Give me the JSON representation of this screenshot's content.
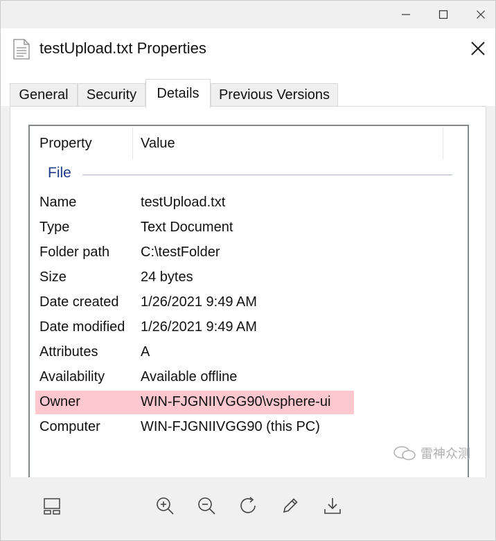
{
  "window": {
    "title": "testUpload.txt Properties"
  },
  "tabs": [
    {
      "label": "General",
      "active": false
    },
    {
      "label": "Security",
      "active": false
    },
    {
      "label": "Details",
      "active": true
    },
    {
      "label": "Previous Versions",
      "active": false
    }
  ],
  "list": {
    "columns": {
      "property": "Property",
      "value": "Value"
    },
    "group": "File",
    "rows": [
      {
        "property": "Name",
        "value": "testUpload.txt"
      },
      {
        "property": "Type",
        "value": "Text Document"
      },
      {
        "property": "Folder path",
        "value": "C:\\testFolder"
      },
      {
        "property": "Size",
        "value": "24 bytes"
      },
      {
        "property": "Date created",
        "value": "1/26/2021 9:49 AM"
      },
      {
        "property": "Date modified",
        "value": "1/26/2021 9:49 AM"
      },
      {
        "property": "Attributes",
        "value": "A"
      },
      {
        "property": "Availability",
        "value": "Available offline"
      },
      {
        "property": "Owner",
        "value": "WIN-FJGNIIVGG90\\vsphere-ui",
        "highlighted": true
      },
      {
        "property": "Computer",
        "value": "WIN-FJGNIIVGG90 (this PC)"
      }
    ]
  },
  "watermark": {
    "text": "雷神众测"
  },
  "colors": {
    "highlight": "#ffc7ce",
    "group_label": "#1e3a8a",
    "chrome": "#f0f0f0"
  },
  "icons": {
    "title_file": "file-text-icon",
    "toolbar": [
      "layout-icon",
      "zoom-in-icon",
      "zoom-out-icon",
      "rotate-icon",
      "edit-pencil-icon",
      "download-icon"
    ]
  }
}
